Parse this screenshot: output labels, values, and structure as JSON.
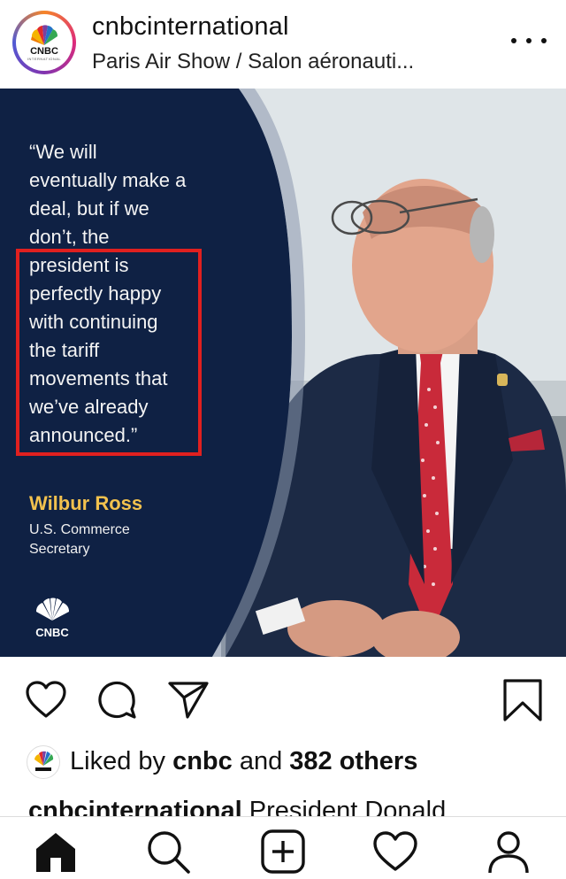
{
  "header": {
    "username": "cnbcinternational",
    "location": "Paris Air Show / Salon aéronauti...",
    "avatar_text": "CNBC",
    "avatar_subtext": "INTERNATIONAL"
  },
  "post": {
    "quote_lines": [
      "“We will",
      "eventually make a",
      "deal, but if we",
      "don’t, the",
      "president is",
      "perfectly happy",
      "with continuing",
      "the tariff",
      "movements that",
      "we’ve already",
      "announced.”"
    ],
    "person_name": "Wilbur Ross",
    "person_title_line1": "U.S. Commerce",
    "person_title_line2": "Secretary",
    "logo_text": "CNBC"
  },
  "likes": {
    "prefix": "Liked by ",
    "user": "cnbc",
    "middle": " and ",
    "others": "382 others"
  },
  "caption": {
    "username": "cnbcinternational",
    "text": " President Donald"
  },
  "icons": {
    "like": "heart-icon",
    "comment": "comment-icon",
    "share": "send-icon",
    "save": "bookmark-icon",
    "home": "home-icon",
    "search": "search-icon",
    "new_post": "add-post-icon",
    "activity": "heart-icon",
    "profile": "profile-icon"
  },
  "colors": {
    "navy": "#0f2144",
    "highlight_border": "#e0201f",
    "name_gold": "#f2c14e"
  }
}
